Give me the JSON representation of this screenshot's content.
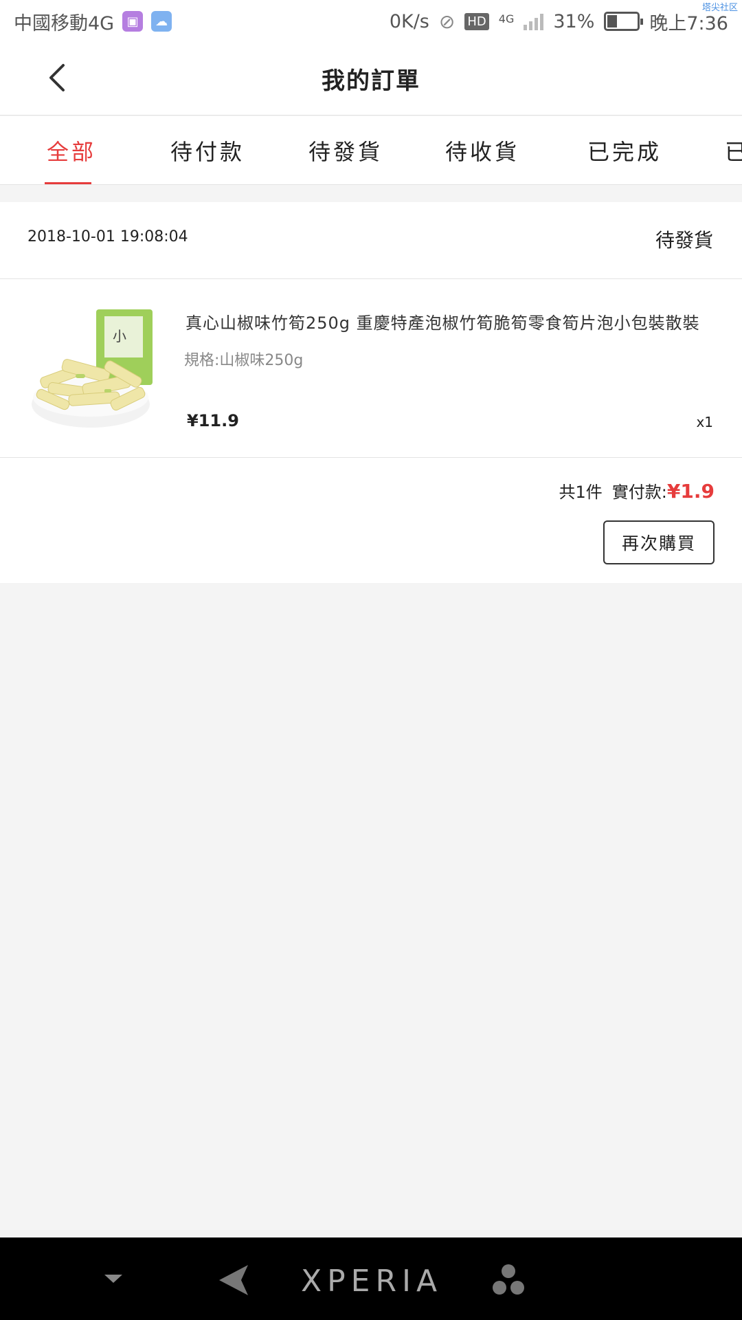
{
  "status_bar": {
    "carrier": "中國移動4G",
    "speed": "0K/s",
    "hd": "HD",
    "network": "4G",
    "battery": "31%",
    "time": "晚上7:36",
    "watermark": "塔尖社区"
  },
  "header": {
    "title": "我的訂單"
  },
  "tabs": [
    {
      "label": "全部",
      "active": true
    },
    {
      "label": "待付款",
      "active": false
    },
    {
      "label": "待發貨",
      "active": false
    },
    {
      "label": "待收貨",
      "active": false
    },
    {
      "label": "已完成",
      "active": false
    },
    {
      "label": "已",
      "active": false
    }
  ],
  "order": {
    "time": "2018-10-01 19:08:04",
    "status": "待發貨",
    "product": {
      "name": "真心山椒味竹筍250g 重慶特產泡椒竹筍脆筍零食筍片泡小包裝散裝",
      "spec": "規格:山椒味250g",
      "price": "¥11.9",
      "qty": "x1"
    },
    "summary": {
      "count": "共1件",
      "paid_label": "實付款:",
      "paid_amount": "¥1.9"
    },
    "rebuy_label": "再次購買"
  },
  "nav": {
    "brand": "XPERIA"
  },
  "colors": {
    "accent": "#e63c3c",
    "background": "#f4f4f4",
    "nav": "#000000"
  }
}
